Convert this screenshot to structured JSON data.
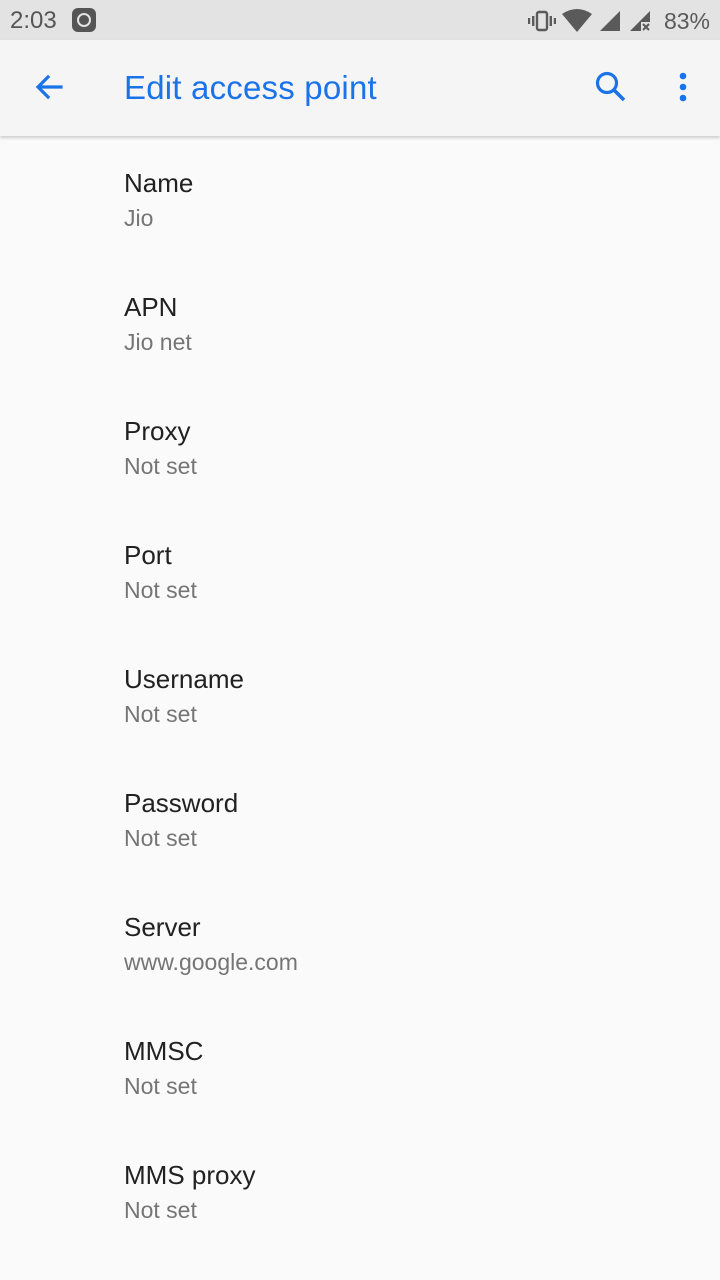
{
  "status_bar": {
    "time": "2:03",
    "battery": "83%"
  },
  "app_bar": {
    "title": "Edit access point",
    "back_icon": "arrow-back-icon",
    "search_icon": "search-icon",
    "more_icon": "more-vert-icon"
  },
  "colors": {
    "accent": "#1a73e8",
    "title_text": "#212121",
    "summary_text": "#757575",
    "background": "#fafafa"
  },
  "preferences": [
    {
      "title": "Name",
      "summary": "Jio"
    },
    {
      "title": "APN",
      "summary": "Jio net"
    },
    {
      "title": "Proxy",
      "summary": "Not set"
    },
    {
      "title": "Port",
      "summary": "Not set"
    },
    {
      "title": "Username",
      "summary": "Not set"
    },
    {
      "title": "Password",
      "summary": "Not set"
    },
    {
      "title": "Server",
      "summary": "www.google.com"
    },
    {
      "title": "MMSC",
      "summary": "Not set"
    },
    {
      "title": "MMS proxy",
      "summary": "Not set"
    }
  ]
}
